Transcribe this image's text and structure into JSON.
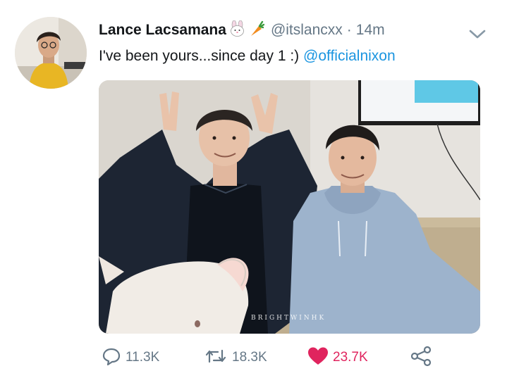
{
  "tweet": {
    "display_name": "Lance Lacsamana",
    "name_emojis": [
      "rabbit-face-emoji",
      "carrot-emoji"
    ],
    "handle": "@itslancxx",
    "separator": "·",
    "time": "14m",
    "text": "I've been yours...since day 1 :) ",
    "mention": "@officialnixon",
    "media_watermark": "BRIGHTWINHK"
  },
  "actions": {
    "replies": "11.3K",
    "retweets": "18.3K",
    "likes": "23.7K",
    "liked": true
  },
  "colors": {
    "text": "#14171a",
    "secondary": "#657786",
    "link": "#1b95e0",
    "like": "#e0245e"
  },
  "icons": [
    "reply-icon",
    "retweet-icon",
    "heart-icon",
    "share-icon",
    "chevron-down-icon"
  ]
}
